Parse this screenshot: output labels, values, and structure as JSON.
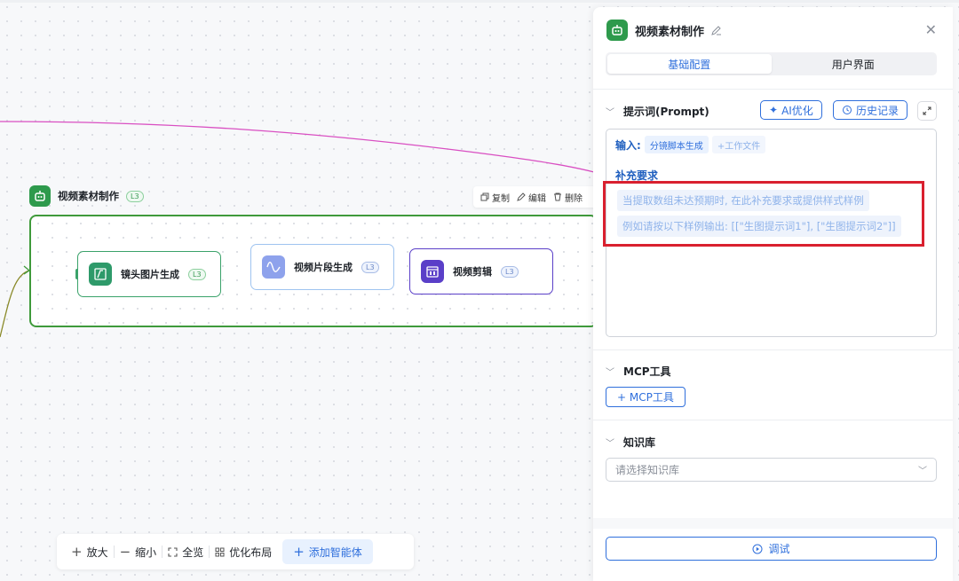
{
  "canvas": {
    "group": {
      "title": "视频素材制作",
      "level": "L3",
      "actions": {
        "copy": "复制",
        "edit": "编辑",
        "delete": "删除"
      }
    },
    "nodes": [
      {
        "title": "镜头图片生成",
        "level": "L3",
        "icon": "image-edit-icon",
        "color": "#2e9a6a"
      },
      {
        "title": "视频片段生成",
        "level": "L3",
        "icon": "waveform-icon",
        "color": "#7d95e8"
      },
      {
        "title": "视频剪辑",
        "level": "L3",
        "icon": "video-edit-icon",
        "color": "#5a3fc8"
      }
    ]
  },
  "toolbar": {
    "zoom_in": "放大",
    "zoom_out": "缩小",
    "fit": "全览",
    "optimize": "优化布局",
    "add_agent": "添加智能体"
  },
  "panel": {
    "title": "视频素材制作",
    "tabs": [
      {
        "label": "基础配置",
        "active": true
      },
      {
        "label": "用户界面",
        "active": false
      }
    ],
    "prompt": {
      "heading": "提示词(Prompt)",
      "ai_optimize": "AI优化",
      "history": "历史记录",
      "input_label": "输入:",
      "input_tags": [
        "分镜脚本生成",
        "+工作文件"
      ],
      "supplement_label": "补充要求",
      "placeholder_lines": [
        "当提取数组未达预期时, 在此补充要求或提供样式样例",
        "例如请按以下样例输出: [[\"生图提示词1\"], [\"生图提示词2\"]]"
      ]
    },
    "mcp": {
      "heading": "MCP工具",
      "add_button": "+ MCP工具"
    },
    "knowledge": {
      "heading": "知识库",
      "placeholder": "请选择知识库"
    },
    "debug_button": "调试"
  },
  "colors": {
    "accent": "#2f6fdc",
    "group_border": "#3f9a3b",
    "highlight": "#d9202f"
  }
}
